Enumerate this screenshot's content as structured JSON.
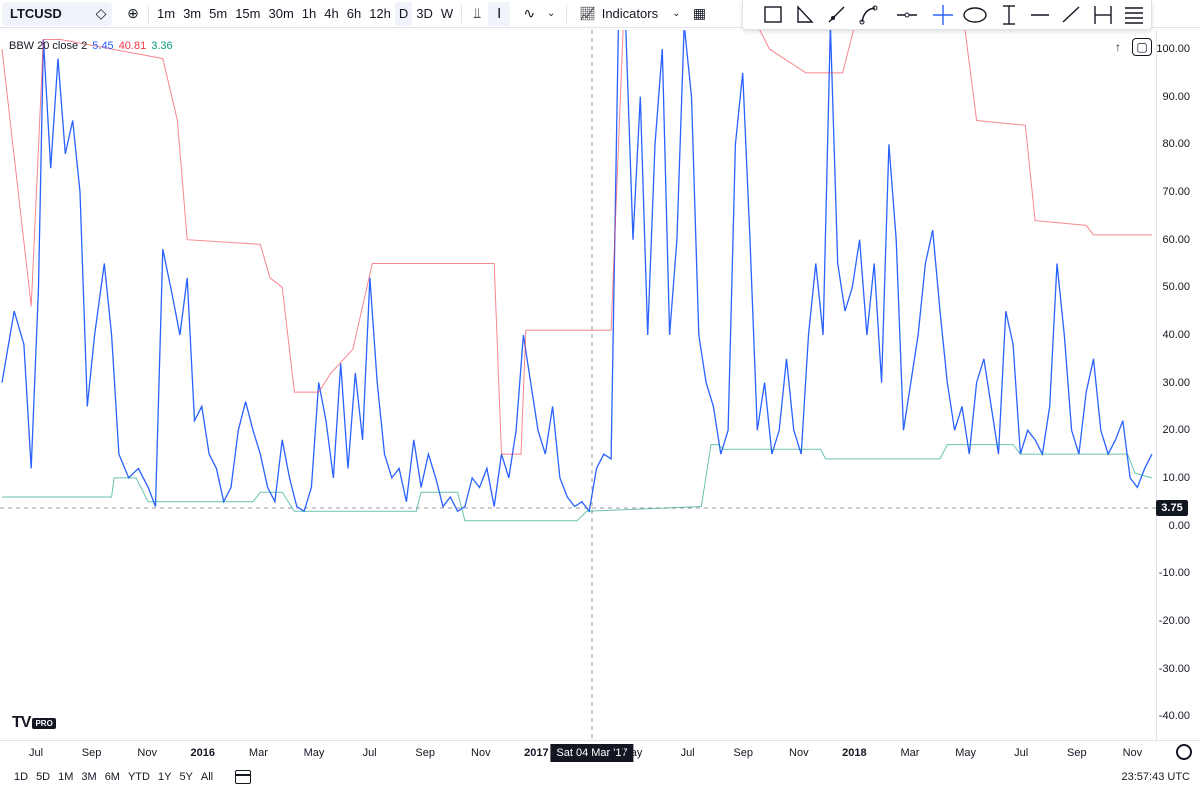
{
  "toolbar": {
    "symbol": "LTCUSD",
    "intervals": [
      "1m",
      "3m",
      "5m",
      "15m",
      "30m",
      "1h",
      "4h",
      "6h",
      "12h",
      "D",
      "3D",
      "W"
    ],
    "active_interval": "D",
    "indicators_label": "Indicators",
    "icons": [
      "compare-icon",
      "add-symbol-icon",
      "bar-style-icon",
      "candle-style-icon",
      "line-style-icon",
      "chevron-down-icon",
      "indicators-icon",
      "templates-icon"
    ]
  },
  "drawing_tools": [
    "rectangle-icon",
    "triangle-icon",
    "ray-icon",
    "path-icon",
    "horizontal-ray-icon",
    "cross-line-icon",
    "ellipse-icon",
    "date-range-icon",
    "horizontal-line-icon",
    "trend-line-icon",
    "price-range-icon",
    "fib-icon"
  ],
  "legend": {
    "name": "BBW 20 close 2",
    "value_1": "5.45",
    "value_2": "40.81",
    "value_3": "3.36",
    "colors": {
      "bbw": "#2962ff",
      "upper": "#f23645",
      "lower": "#089981"
    }
  },
  "y_axis": {
    "ticks": [
      "100.00",
      "90.00",
      "80.00",
      "70.00",
      "60.00",
      "50.00",
      "40.00",
      "30.00",
      "20.00",
      "10.00",
      "0.00",
      "-10.00",
      "-20.00",
      "-30.00",
      "-40.00"
    ],
    "current_price": "3.75"
  },
  "x_axis": {
    "ticks": [
      {
        "label": "Jul",
        "bold": false
      },
      {
        "label": "Sep",
        "bold": false
      },
      {
        "label": "Nov",
        "bold": false
      },
      {
        "label": "2016",
        "bold": true
      },
      {
        "label": "Mar",
        "bold": false
      },
      {
        "label": "May",
        "bold": false
      },
      {
        "label": "Jul",
        "bold": false
      },
      {
        "label": "Sep",
        "bold": false
      },
      {
        "label": "Nov",
        "bold": false
      },
      {
        "label": "2017",
        "bold": true
      },
      {
        "label": "May",
        "bold": false
      },
      {
        "label": "Jul",
        "bold": false
      },
      {
        "label": "Sep",
        "bold": false
      },
      {
        "label": "Nov",
        "bold": false
      },
      {
        "label": "2018",
        "bold": true
      },
      {
        "label": "Mar",
        "bold": false
      },
      {
        "label": "May",
        "bold": false
      },
      {
        "label": "Jul",
        "bold": false
      },
      {
        "label": "Sep",
        "bold": false
      },
      {
        "label": "Nov",
        "bold": false
      }
    ],
    "crosshair_date": "Sat 04 Mar '17"
  },
  "bottom_bar": {
    "ranges": [
      "1D",
      "5D",
      "1M",
      "3M",
      "6M",
      "YTD",
      "1Y",
      "5Y",
      "All"
    ],
    "time": "23:57:43 UTC"
  },
  "logo": {
    "mark": "TV",
    "badge": "PRO"
  },
  "chart_data": {
    "type": "line",
    "title": "",
    "ylim": [
      -45,
      104
    ],
    "x_range": [
      "2015-06",
      "2018-11"
    ],
    "series": [
      {
        "name": "BBW",
        "color": "#2962ff",
        "points": [
          [
            0,
            30
          ],
          [
            0.5,
            45
          ],
          [
            0.9,
            38
          ],
          [
            1.2,
            12
          ],
          [
            1.5,
            50
          ],
          [
            1.7,
            102
          ],
          [
            2,
            75
          ],
          [
            2.3,
            98
          ],
          [
            2.6,
            78
          ],
          [
            2.9,
            85
          ],
          [
            3.2,
            70
          ],
          [
            3.5,
            25
          ],
          [
            3.8,
            40
          ],
          [
            4.2,
            55
          ],
          [
            4.5,
            40
          ],
          [
            4.8,
            15
          ],
          [
            5.2,
            10
          ],
          [
            5.6,
            12
          ],
          [
            6,
            8
          ],
          [
            6.3,
            4
          ],
          [
            6.6,
            58
          ],
          [
            7,
            48
          ],
          [
            7.3,
            40
          ],
          [
            7.6,
            52
          ],
          [
            7.9,
            22
          ],
          [
            8.2,
            25
          ],
          [
            8.5,
            15
          ],
          [
            8.8,
            12
          ],
          [
            9.1,
            5
          ],
          [
            9.4,
            8
          ],
          [
            9.7,
            20
          ],
          [
            10,
            26
          ],
          [
            10.3,
            20
          ],
          [
            10.6,
            15
          ],
          [
            10.9,
            8
          ],
          [
            11.2,
            5
          ],
          [
            11.5,
            18
          ],
          [
            11.8,
            10
          ],
          [
            12.1,
            4
          ],
          [
            12.4,
            3
          ],
          [
            12.7,
            8
          ],
          [
            13,
            30
          ],
          [
            13.3,
            22
          ],
          [
            13.6,
            10
          ],
          [
            13.9,
            34
          ],
          [
            14.2,
            12
          ],
          [
            14.5,
            32
          ],
          [
            14.8,
            18
          ],
          [
            15.1,
            52
          ],
          [
            15.4,
            30
          ],
          [
            15.7,
            15
          ],
          [
            16,
            10
          ],
          [
            16.3,
            12
          ],
          [
            16.6,
            5
          ],
          [
            16.9,
            18
          ],
          [
            17.2,
            8
          ],
          [
            17.5,
            15
          ],
          [
            17.8,
            10
          ],
          [
            18.1,
            4
          ],
          [
            18.4,
            6
          ],
          [
            18.7,
            3
          ],
          [
            19,
            4
          ],
          [
            19.3,
            10
          ],
          [
            19.6,
            8
          ],
          [
            19.9,
            12
          ],
          [
            20.2,
            4
          ],
          [
            20.5,
            15
          ],
          [
            20.8,
            10
          ],
          [
            21.1,
            20
          ],
          [
            21.4,
            40
          ],
          [
            21.7,
            30
          ],
          [
            22,
            20
          ],
          [
            22.3,
            15
          ],
          [
            22.6,
            25
          ],
          [
            22.9,
            10
          ],
          [
            23.2,
            6
          ],
          [
            23.5,
            4
          ],
          [
            23.8,
            5
          ],
          [
            24.1,
            3
          ],
          [
            24.4,
            12
          ],
          [
            24.7,
            15
          ],
          [
            25,
            14
          ],
          [
            25.3,
            115
          ],
          [
            25.6,
            120
          ],
          [
            25.9,
            60
          ],
          [
            26.2,
            90
          ],
          [
            26.5,
            40
          ],
          [
            26.8,
            80
          ],
          [
            27.1,
            100
          ],
          [
            27.4,
            40
          ],
          [
            27.7,
            60
          ],
          [
            28,
            110
          ],
          [
            28.3,
            90
          ],
          [
            28.6,
            40
          ],
          [
            28.9,
            30
          ],
          [
            29.2,
            25
          ],
          [
            29.5,
            15
          ],
          [
            29.8,
            20
          ],
          [
            30.1,
            80
          ],
          [
            30.4,
            95
          ],
          [
            30.7,
            60
          ],
          [
            31,
            20
          ],
          [
            31.3,
            30
          ],
          [
            31.6,
            15
          ],
          [
            31.9,
            20
          ],
          [
            32.2,
            35
          ],
          [
            32.5,
            20
          ],
          [
            32.8,
            15
          ],
          [
            33.1,
            40
          ],
          [
            33.4,
            55
          ],
          [
            33.7,
            40
          ],
          [
            34,
            110
          ],
          [
            34.3,
            55
          ],
          [
            34.6,
            45
          ],
          [
            34.9,
            50
          ],
          [
            35.2,
            60
          ],
          [
            35.5,
            40
          ],
          [
            35.8,
            55
          ],
          [
            36.1,
            30
          ],
          [
            36.4,
            80
          ],
          [
            36.7,
            60
          ],
          [
            37,
            20
          ],
          [
            37.3,
            30
          ],
          [
            37.6,
            40
          ],
          [
            37.9,
            55
          ],
          [
            38.2,
            62
          ],
          [
            38.5,
            45
          ],
          [
            38.8,
            30
          ],
          [
            39.1,
            20
          ],
          [
            39.4,
            25
          ],
          [
            39.7,
            15
          ],
          [
            40,
            30
          ],
          [
            40.3,
            35
          ],
          [
            40.6,
            25
          ],
          [
            40.9,
            15
          ],
          [
            41.2,
            45
          ],
          [
            41.5,
            38
          ],
          [
            41.8,
            15
          ],
          [
            42.1,
            20
          ],
          [
            42.4,
            18
          ],
          [
            42.7,
            15
          ],
          [
            43,
            25
          ],
          [
            43.3,
            55
          ],
          [
            43.6,
            40
          ],
          [
            43.9,
            20
          ],
          [
            44.2,
            15
          ],
          [
            44.5,
            28
          ],
          [
            44.8,
            35
          ],
          [
            45.1,
            20
          ],
          [
            45.4,
            15
          ],
          [
            45.7,
            18
          ],
          [
            46,
            22
          ],
          [
            46.3,
            10
          ],
          [
            46.6,
            8
          ],
          [
            46.9,
            12
          ],
          [
            47.2,
            15
          ]
        ]
      },
      {
        "name": "Upper",
        "color": "#f23645",
        "points": [
          [
            0,
            100
          ],
          [
            1.2,
            46
          ],
          [
            1.7,
            102
          ],
          [
            2.4,
            102
          ],
          [
            6.6,
            98
          ],
          [
            7.2,
            85
          ],
          [
            7.6,
            60
          ],
          [
            10.6,
            59
          ],
          [
            11,
            52
          ],
          [
            11.5,
            50
          ],
          [
            12,
            28
          ],
          [
            13,
            28
          ],
          [
            13.5,
            32
          ],
          [
            14.4,
            37
          ],
          [
            15.2,
            55
          ],
          [
            20.2,
            55
          ],
          [
            20.5,
            15
          ],
          [
            21.3,
            15
          ],
          [
            21.5,
            41
          ],
          [
            25,
            41
          ],
          [
            25.5,
            120
          ],
          [
            31,
            120
          ],
          [
            31.5,
            100
          ],
          [
            33,
            95
          ],
          [
            34.5,
            95
          ],
          [
            35,
            120
          ],
          [
            39.5,
            120
          ],
          [
            40,
            85
          ],
          [
            42,
            84
          ],
          [
            42.4,
            64
          ],
          [
            44.5,
            63
          ],
          [
            44.8,
            61
          ],
          [
            47.2,
            61
          ]
        ]
      },
      {
        "name": "Lower",
        "color": "#089981",
        "points": [
          [
            0,
            6
          ],
          [
            4.5,
            6
          ],
          [
            4.6,
            10
          ],
          [
            5.5,
            10
          ],
          [
            6,
            5
          ],
          [
            10.3,
            5
          ],
          [
            10.6,
            7
          ],
          [
            11.5,
            7
          ],
          [
            12,
            3
          ],
          [
            17,
            3
          ],
          [
            17.2,
            7
          ],
          [
            18.7,
            7
          ],
          [
            19,
            1
          ],
          [
            23.6,
            1
          ],
          [
            24,
            3
          ],
          [
            28.7,
            4
          ],
          [
            29.1,
            17
          ],
          [
            29.4,
            17
          ],
          [
            29.6,
            16
          ],
          [
            33.6,
            16
          ],
          [
            33.8,
            14
          ],
          [
            38.5,
            14
          ],
          [
            38.8,
            17
          ],
          [
            41.5,
            17
          ],
          [
            41.8,
            15
          ],
          [
            46.2,
            15
          ],
          [
            46.5,
            11
          ],
          [
            47.2,
            10
          ]
        ]
      }
    ]
  }
}
